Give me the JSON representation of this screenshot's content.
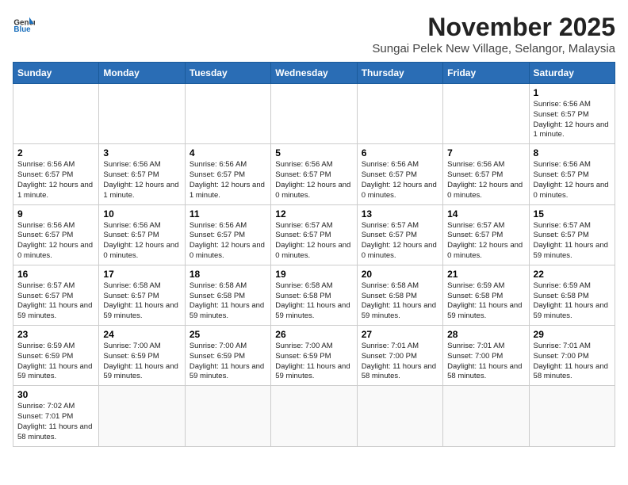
{
  "header": {
    "logo_line1": "General",
    "logo_line2": "Blue",
    "title": "November 2025",
    "subtitle": "Sungai Pelek New Village, Selangor, Malaysia"
  },
  "days_of_week": [
    "Sunday",
    "Monday",
    "Tuesday",
    "Wednesday",
    "Thursday",
    "Friday",
    "Saturday"
  ],
  "weeks": [
    [
      {
        "day": "",
        "info": ""
      },
      {
        "day": "",
        "info": ""
      },
      {
        "day": "",
        "info": ""
      },
      {
        "day": "",
        "info": ""
      },
      {
        "day": "",
        "info": ""
      },
      {
        "day": "",
        "info": ""
      },
      {
        "day": "1",
        "info": "Sunrise: 6:56 AM\nSunset: 6:57 PM\nDaylight: 12 hours and 1 minute."
      }
    ],
    [
      {
        "day": "2",
        "info": "Sunrise: 6:56 AM\nSunset: 6:57 PM\nDaylight: 12 hours and 1 minute."
      },
      {
        "day": "3",
        "info": "Sunrise: 6:56 AM\nSunset: 6:57 PM\nDaylight: 12 hours and 1 minute."
      },
      {
        "day": "4",
        "info": "Sunrise: 6:56 AM\nSunset: 6:57 PM\nDaylight: 12 hours and 1 minute."
      },
      {
        "day": "5",
        "info": "Sunrise: 6:56 AM\nSunset: 6:57 PM\nDaylight: 12 hours and 0 minutes."
      },
      {
        "day": "6",
        "info": "Sunrise: 6:56 AM\nSunset: 6:57 PM\nDaylight: 12 hours and 0 minutes."
      },
      {
        "day": "7",
        "info": "Sunrise: 6:56 AM\nSunset: 6:57 PM\nDaylight: 12 hours and 0 minutes."
      },
      {
        "day": "8",
        "info": "Sunrise: 6:56 AM\nSunset: 6:57 PM\nDaylight: 12 hours and 0 minutes."
      }
    ],
    [
      {
        "day": "9",
        "info": "Sunrise: 6:56 AM\nSunset: 6:57 PM\nDaylight: 12 hours and 0 minutes."
      },
      {
        "day": "10",
        "info": "Sunrise: 6:56 AM\nSunset: 6:57 PM\nDaylight: 12 hours and 0 minutes."
      },
      {
        "day": "11",
        "info": "Sunrise: 6:56 AM\nSunset: 6:57 PM\nDaylight: 12 hours and 0 minutes."
      },
      {
        "day": "12",
        "info": "Sunrise: 6:57 AM\nSunset: 6:57 PM\nDaylight: 12 hours and 0 minutes."
      },
      {
        "day": "13",
        "info": "Sunrise: 6:57 AM\nSunset: 6:57 PM\nDaylight: 12 hours and 0 minutes."
      },
      {
        "day": "14",
        "info": "Sunrise: 6:57 AM\nSunset: 6:57 PM\nDaylight: 12 hours and 0 minutes."
      },
      {
        "day": "15",
        "info": "Sunrise: 6:57 AM\nSunset: 6:57 PM\nDaylight: 11 hours and 59 minutes."
      }
    ],
    [
      {
        "day": "16",
        "info": "Sunrise: 6:57 AM\nSunset: 6:57 PM\nDaylight: 11 hours and 59 minutes."
      },
      {
        "day": "17",
        "info": "Sunrise: 6:58 AM\nSunset: 6:57 PM\nDaylight: 11 hours and 59 minutes."
      },
      {
        "day": "18",
        "info": "Sunrise: 6:58 AM\nSunset: 6:58 PM\nDaylight: 11 hours and 59 minutes."
      },
      {
        "day": "19",
        "info": "Sunrise: 6:58 AM\nSunset: 6:58 PM\nDaylight: 11 hours and 59 minutes."
      },
      {
        "day": "20",
        "info": "Sunrise: 6:58 AM\nSunset: 6:58 PM\nDaylight: 11 hours and 59 minutes."
      },
      {
        "day": "21",
        "info": "Sunrise: 6:59 AM\nSunset: 6:58 PM\nDaylight: 11 hours and 59 minutes."
      },
      {
        "day": "22",
        "info": "Sunrise: 6:59 AM\nSunset: 6:58 PM\nDaylight: 11 hours and 59 minutes."
      }
    ],
    [
      {
        "day": "23",
        "info": "Sunrise: 6:59 AM\nSunset: 6:59 PM\nDaylight: 11 hours and 59 minutes."
      },
      {
        "day": "24",
        "info": "Sunrise: 7:00 AM\nSunset: 6:59 PM\nDaylight: 11 hours and 59 minutes."
      },
      {
        "day": "25",
        "info": "Sunrise: 7:00 AM\nSunset: 6:59 PM\nDaylight: 11 hours and 59 minutes."
      },
      {
        "day": "26",
        "info": "Sunrise: 7:00 AM\nSunset: 6:59 PM\nDaylight: 11 hours and 59 minutes."
      },
      {
        "day": "27",
        "info": "Sunrise: 7:01 AM\nSunset: 7:00 PM\nDaylight: 11 hours and 58 minutes."
      },
      {
        "day": "28",
        "info": "Sunrise: 7:01 AM\nSunset: 7:00 PM\nDaylight: 11 hours and 58 minutes."
      },
      {
        "day": "29",
        "info": "Sunrise: 7:01 AM\nSunset: 7:00 PM\nDaylight: 11 hours and 58 minutes."
      }
    ],
    [
      {
        "day": "30",
        "info": "Sunrise: 7:02 AM\nSunset: 7:01 PM\nDaylight: 11 hours and 58 minutes."
      },
      {
        "day": "",
        "info": ""
      },
      {
        "day": "",
        "info": ""
      },
      {
        "day": "",
        "info": ""
      },
      {
        "day": "",
        "info": ""
      },
      {
        "day": "",
        "info": ""
      },
      {
        "day": "",
        "info": ""
      }
    ]
  ]
}
